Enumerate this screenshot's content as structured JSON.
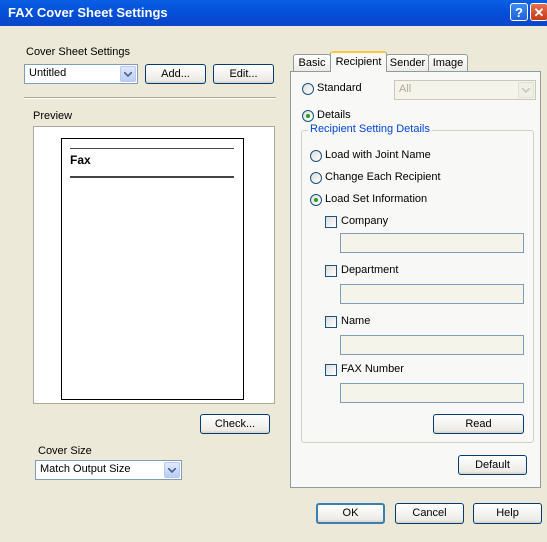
{
  "window": {
    "title": "FAX Cover Sheet Settings",
    "help_glyph": "?",
    "close_glyph": "✕"
  },
  "cover_sheet": {
    "label": "Cover Sheet Settings",
    "selected": "Untitled",
    "add_label": "Add...",
    "edit_label": "Edit..."
  },
  "preview": {
    "label": "Preview",
    "page_header": "Fax",
    "check_label": "Check..."
  },
  "cover_size": {
    "label": "Cover Size",
    "selected": "Match Output Size"
  },
  "tabs": [
    {
      "label": "Basic",
      "active": false
    },
    {
      "label": "Recipient",
      "active": true
    },
    {
      "label": "Sender",
      "active": false
    },
    {
      "label": "Image",
      "active": false
    }
  ],
  "recipient": {
    "standard_label": "Standard",
    "standard_select": "All",
    "details_label": "Details",
    "group_title": "Recipient Setting Details",
    "option_joint_name": "Load with Joint Name",
    "option_each_recipient": "Change Each Recipient",
    "option_set_info": "Load Set Information",
    "fields": [
      {
        "label": "Company",
        "value": ""
      },
      {
        "label": "Department",
        "value": ""
      },
      {
        "label": "Name",
        "value": ""
      },
      {
        "label": "FAX Number",
        "value": ""
      }
    ],
    "read_label": "Read",
    "default_label": "Default"
  },
  "footer": {
    "ok_label": "OK",
    "cancel_label": "Cancel",
    "help_label": "Help"
  },
  "colors": {
    "title_bar": "#0A5FE4",
    "dialog_bg": "#ECE9D8",
    "group_title": "#0046D5",
    "radio_dot": "#21A121"
  }
}
